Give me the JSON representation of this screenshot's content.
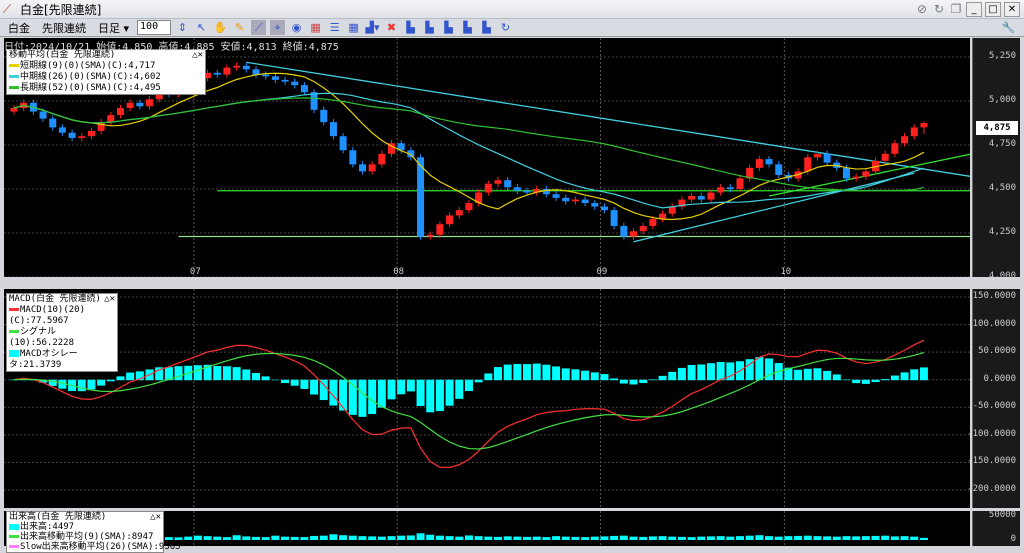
{
  "window": {
    "title": "白金[先限連続]",
    "app_icon": "chart-icon",
    "controls": [
      "link-icon",
      "refresh-icon",
      "restore-icon",
      "minimize-icon",
      "maximize-icon",
      "close-icon"
    ]
  },
  "toolbar": {
    "commodity": "白金",
    "contract": "先限連続",
    "period": "日足",
    "count": "100",
    "icons": [
      "pointer-icon",
      "hand-icon",
      "pencil-icon",
      "draw-icon",
      "crosshair-icon",
      "scroll-icon",
      "chart-setting-icon",
      "grid-h-icon",
      "grid-icon",
      "bar-chart-icon",
      "delete-icon",
      "layout1-icon",
      "layout2-icon",
      "layout3-icon",
      "layout4-icon",
      "layout5-icon",
      "reload-icon"
    ],
    "settings_icon": "wrench-icon"
  },
  "info": "日付:2024/10/21 始値:4,850 高値:4,885 安値:4,813 終値:4,875",
  "ma_legend": {
    "title": "移動平均(白金 先限連続)",
    "items": [
      {
        "label": "短期線(9)(0)(SMA)(C):4,717",
        "color": "#e6d000"
      },
      {
        "label": "中期線(26)(0)(SMA)(C):4,602",
        "color": "#40d0e0"
      },
      {
        "label": "長期線(52)(0)(SMA)(C):4,495",
        "color": "#30c030"
      }
    ]
  },
  "macd_legend": {
    "title": "MACD(白金 先限連続)",
    "items": [
      {
        "label": "MACD(10)(20)(C):77.5967",
        "color": "#ff3030"
      },
      {
        "label": "シグナル(10):56.2228",
        "color": "#40e040"
      },
      {
        "label": "MACDオシレータ:21.3739",
        "color": "#00ffff"
      }
    ]
  },
  "vol_legend": {
    "title": "出来高(白金 先限連続)",
    "items": [
      {
        "label": "出来高:4497",
        "color": "#00ffff"
      },
      {
        "label": "出来高移動平均(9)(SMA):8947",
        "color": "#40e040"
      },
      {
        "label": "Slow出来高移動平均(26)(SMA):9365",
        "color": "#ff80ff"
      }
    ]
  },
  "last_price": "4,875",
  "colors": {
    "up": "#ff2020",
    "down": "#1e90ff",
    "background": "#000000"
  },
  "chart_data": [
    {
      "type": "candlestick",
      "months": [
        {
          "label": "07",
          "index": 19
        },
        {
          "label": "08",
          "index": 40
        },
        {
          "label": "09",
          "index": 61
        },
        {
          "label": "10",
          "index": 80
        }
      ],
      "yticks": [
        "5,250",
        "5,000",
        "4,750",
        "4,500",
        "4,250",
        "4,000"
      ],
      "ylim": [
        4000,
        5250
      ],
      "close": [
        4960,
        4990,
        4940,
        4900,
        4850,
        4820,
        4790,
        4800,
        4830,
        4880,
        4920,
        4960,
        4990,
        4970,
        5010,
        5050,
        5040,
        5080,
        5100,
        5130,
        5160,
        5150,
        5190,
        5200,
        5180,
        5150,
        5140,
        5120,
        5110,
        5090,
        5050,
        4950,
        4880,
        4800,
        4720,
        4640,
        4600,
        4640,
        4700,
        4760,
        4720,
        4680,
        4230,
        4240,
        4300,
        4350,
        4380,
        4420,
        4480,
        4530,
        4550,
        4510,
        4490,
        4480,
        4500,
        4470,
        4450,
        4430,
        4440,
        4420,
        4400,
        4380,
        4290,
        4230,
        4260,
        4290,
        4330,
        4360,
        4400,
        4440,
        4460,
        4440,
        4480,
        4510,
        4500,
        4560,
        4620,
        4670,
        4640,
        4580,
        4560,
        4600,
        4680,
        4700,
        4650,
        4620,
        4560,
        4570,
        4600,
        4660,
        4700,
        4760,
        4800,
        4850,
        4875
      ],
      "last_bar": {
        "open": 4850,
        "high": 4885,
        "low": 4813,
        "close": 4875
      },
      "trendlines": [
        {
          "from": [
            24,
            5220
          ],
          "to": [
            99,
            4570
          ],
          "color": "#40d0e0"
        },
        {
          "from": [
            21,
            4490
          ],
          "to": [
            99,
            4490
          ],
          "color": "#30e030"
        },
        {
          "from": [
            17,
            4230
          ],
          "to": [
            99,
            4230
          ],
          "color": "#90e090"
        },
        {
          "from": [
            64,
            4200
          ],
          "to": [
            93,
            4590
          ],
          "color": "#40d0e0"
        },
        {
          "from": [
            78,
            4460
          ],
          "to": [
            99,
            4700
          ],
          "color": "#30e030"
        }
      ]
    },
    {
      "type": "macd",
      "yticks": [
        "150.0000",
        "100.0000",
        "50.0000",
        "0.0000",
        "-50.0000",
        "-100.0000",
        "-150.0000",
        "-200.0000"
      ],
      "ylim": [
        -200,
        150
      ]
    },
    {
      "type": "bar",
      "name": "出来高",
      "yticks": [
        "50000",
        "0"
      ],
      "ylim": [
        0,
        50000
      ],
      "values": [
        7000,
        6500,
        8000,
        6000,
        5500,
        9000,
        7000,
        6000,
        6500,
        8000,
        7500,
        6000,
        5000,
        6000,
        7000,
        8500,
        6000,
        5500,
        7000,
        9000,
        8000,
        7000,
        6000,
        10000,
        7500,
        6500,
        6000,
        9000,
        7000,
        6500,
        6000,
        8500,
        9000,
        12000,
        10000,
        9000,
        8000,
        7500,
        7000,
        8000,
        9000,
        9500,
        14000,
        11000,
        9000,
        8000,
        7000,
        9500,
        8000,
        7000,
        6500,
        7500,
        7000,
        6500,
        7000,
        6000,
        8000,
        7000,
        6500,
        6000,
        7000,
        7500,
        8500,
        9000,
        7000,
        6500,
        7500,
        8000,
        7000,
        6500,
        6000,
        7000,
        7500,
        8000,
        7000,
        8000,
        9000,
        10000,
        8000,
        7000,
        8000,
        8500,
        9000,
        8000,
        7500,
        7000,
        8000,
        7500,
        8000,
        8500,
        9000,
        7500,
        8000,
        7000,
        4497
      ]
    }
  ]
}
